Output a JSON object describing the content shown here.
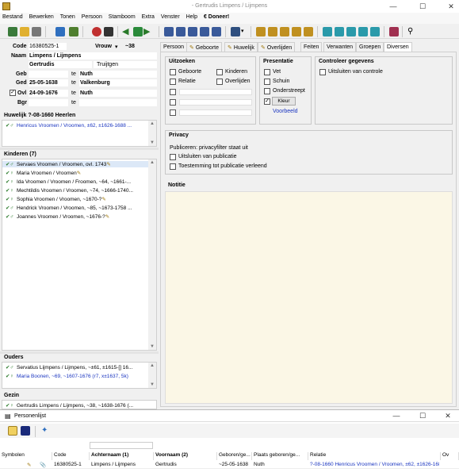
{
  "window": {
    "title": "- Gertrudis Limpens / Lijmpens",
    "min": "—",
    "max": "☐",
    "close": "✕"
  },
  "menu": [
    "Bestand",
    "Bewerken",
    "Tonen",
    "Persoon",
    "Stamboom",
    "Extra",
    "Venster",
    "Help",
    "€ Doneer!"
  ],
  "person": {
    "code_label": "Code",
    "code": "16380525-1",
    "sex": "Vrouw",
    "age": "~38",
    "name_label": "Naam",
    "surname": "Limpens / Lijmpens",
    "given": "Gertrudis",
    "nickname": "Truijtgen",
    "geb_label": "Geb",
    "geb_te": "te",
    "geb_place": "Nuth",
    "ged_label": "Ged",
    "ged_date": "25-05-1638",
    "ged_te": "te",
    "ged_place": "Valkenburg",
    "ovl_label": "Ovl",
    "ovl_date": "24-09-1676",
    "ovl_te": "te",
    "ovl_place": "Nuth",
    "bgr_label": "Bgr",
    "bgr_te": "te"
  },
  "marriage": {
    "title": "Huwelijk ?-08-1660 Heerlen",
    "partner": "Henricus Vroomen / Vroomen, ±62, ±1626-1688 ..."
  },
  "children": {
    "title": "Kinderen (7)",
    "items": [
      "Servaes Vroomen / Vroomen, ovl. 1743",
      "Maria Vroomen / Vroomen",
      "Ida Vroomen / Vroomen / Froomen, ~64, ~1661-...",
      "Mechtildis Vroomen / Vroomen, ~74, ~1666-1740...",
      "Sophia Vroomen / Vroomen, ~1670-?",
      "Hendrick Vroomen / Vroomen, ~85, ~1673-1758 ...",
      "Joannes Vroomen / Vroomen, ~1676-?"
    ]
  },
  "parents": {
    "title": "Ouders",
    "items": [
      "Servatius Lijmpens / Lijmpens, ~±61, ±1615-[] 16...",
      "Maria Boonen, ~69, ~1607-1676 (r7, x±1637, 5k)"
    ]
  },
  "gezin": {
    "title": "Gezin",
    "item": "Gertrudis Limpens / Lijmpens, ~38, ~1638-1676 (..."
  },
  "tabs": [
    "Persoon",
    "Geboorte",
    "Huwelijk",
    "Overlijden",
    "Feiten",
    "Verwanten",
    "Groepen",
    "Diversen"
  ],
  "active_tab": "Diversen",
  "uitzoeken": {
    "title": "Uitzoeken",
    "items": [
      "Geboorte",
      "Kinderen",
      "Relatie",
      "Overlijden"
    ]
  },
  "presentatie": {
    "title": "Presentatie",
    "items": [
      "Vet",
      "Schuin",
      "Onderstreept"
    ],
    "kleur": "Kleur",
    "voorbeeld": "Voorbeeld"
  },
  "controle": {
    "title": "Controleer gegevens",
    "item": "Uitsluiten van controle"
  },
  "privacy": {
    "title": "Privacy",
    "status": "Publiceren: privacyfilter staat uit",
    "items": [
      "Uitsluiten van publicatie",
      "Toestemming tot publicatie verleend"
    ]
  },
  "notitie": {
    "title": "Notitie"
  },
  "bottom": {
    "title": "Personenlijst",
    "columns": [
      "Symbolen",
      "Code",
      "Achternaam (1)",
      "Voornaam (2)",
      "Geboren/ge...",
      "Plaats geboren/ge...",
      "Relatie",
      "Ov"
    ],
    "row": {
      "code": "16380525-1",
      "surname": "Limpens / Lijmpens",
      "given": "Gertrudis",
      "born": "~25-05-1638",
      "place": "Nuth",
      "relation": "?-08-1660 Henricus Vroomen / Vroomen, ±62, ±1626-1688 ..."
    }
  },
  "colors": {
    "link": "#1a35c0",
    "notitie_bg": "#fbf7e6",
    "tab_active": "#ffffff",
    "selection": "#dce8f7"
  }
}
